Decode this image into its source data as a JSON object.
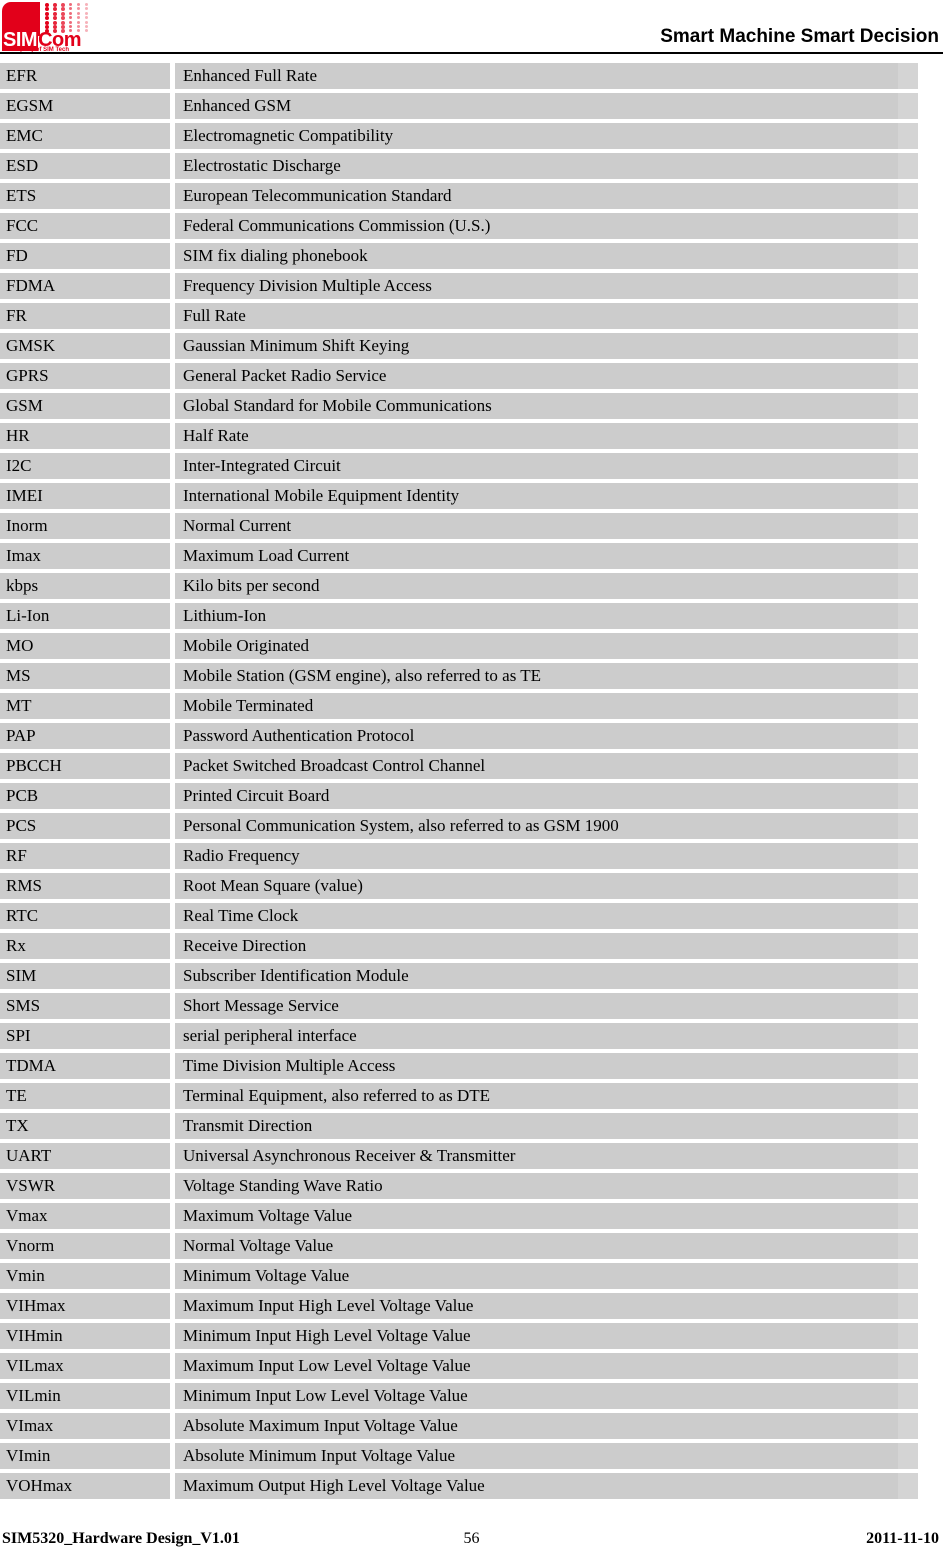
{
  "header": {
    "logo_word_sim": "SIM",
    "logo_word_com": "Com",
    "logo_tagline": "A company of SIM Tech",
    "tagline": "Smart Machine Smart Decision",
    "brand_color": "#e2001a"
  },
  "table": {
    "cell_color": "#cccccc",
    "rows": [
      {
        "term": "EFR",
        "definition": "Enhanced Full Rate"
      },
      {
        "term": "EGSM",
        "definition": "Enhanced GSM"
      },
      {
        "term": "EMC",
        "definition": "Electromagnetic Compatibility"
      },
      {
        "term": "ESD",
        "definition": "Electrostatic Discharge"
      },
      {
        "term": "ETS",
        "definition": "European Telecommunication Standard"
      },
      {
        "term": "FCC",
        "definition": "Federal Communications Commission (U.S.)"
      },
      {
        "term": "FD",
        "definition": "SIM fix dialing phonebook"
      },
      {
        "term": "FDMA",
        "definition": "Frequency Division Multiple Access"
      },
      {
        "term": "FR",
        "definition": "Full Rate"
      },
      {
        "term": "GMSK",
        "definition": "Gaussian Minimum Shift Keying"
      },
      {
        "term": "GPRS",
        "definition": "General Packet Radio Service"
      },
      {
        "term": "GSM",
        "definition": "Global Standard for Mobile Communications"
      },
      {
        "term": "HR",
        "definition": "Half Rate"
      },
      {
        "term": "I2C",
        "definition": "Inter-Integrated Circuit"
      },
      {
        "term": "IMEI",
        "definition": "International Mobile Equipment Identity"
      },
      {
        "term": "Inorm",
        "definition": "Normal Current"
      },
      {
        "term": "Imax",
        "definition": "Maximum Load Current"
      },
      {
        "term": "kbps",
        "definition": "Kilo bits per second"
      },
      {
        "term": "Li-Ion",
        "definition": "Lithium-Ion"
      },
      {
        "term": "MO",
        "definition": "Mobile Originated"
      },
      {
        "term": "MS",
        "definition": "Mobile Station (GSM engine), also referred to as TE"
      },
      {
        "term": "MT",
        "definition": "Mobile Terminated"
      },
      {
        "term": "PAP",
        "definition": "Password Authentication Protocol"
      },
      {
        "term": "PBCCH",
        "definition": "Packet Switched Broadcast Control Channel"
      },
      {
        "term": "PCB",
        "definition": "Printed Circuit Board"
      },
      {
        "term": "PCS",
        "definition": "Personal Communication System, also referred to as GSM 1900"
      },
      {
        "term": "RF",
        "definition": "Radio Frequency"
      },
      {
        "term": "RMS",
        "definition": "Root Mean Square (value)"
      },
      {
        "term": "RTC",
        "definition": "Real Time Clock"
      },
      {
        "term": "Rx",
        "definition": "Receive Direction"
      },
      {
        "term": "SIM",
        "definition": "Subscriber Identification Module"
      },
      {
        "term": "SMS",
        "definition": "Short Message Service"
      },
      {
        "term": "SPI",
        "definition": "serial peripheral interface"
      },
      {
        "term": "TDMA",
        "definition": "Time Division Multiple Access"
      },
      {
        "term": "TE",
        "definition": "Terminal Equipment, also referred to as DTE"
      },
      {
        "term": "TX",
        "definition": "Transmit Direction"
      },
      {
        "term": "UART",
        "definition": "Universal Asynchronous Receiver & Transmitter"
      },
      {
        "term": "VSWR",
        "definition": "Voltage Standing Wave Ratio"
      },
      {
        "term": "Vmax",
        "definition": "Maximum Voltage Value"
      },
      {
        "term": "Vnorm",
        "definition": "Normal Voltage Value"
      },
      {
        "term": "Vmin",
        "definition": "Minimum Voltage Value"
      },
      {
        "term": "VIHmax",
        "definition": "Maximum Input High Level Voltage Value"
      },
      {
        "term": "VIHmin",
        "definition": "Minimum Input High Level Voltage Value"
      },
      {
        "term": "VILmax",
        "definition": "Maximum Input Low Level Voltage Value"
      },
      {
        "term": "VILmin",
        "definition": "Minimum Input Low Level Voltage Value"
      },
      {
        "term": "VImax",
        "definition": "Absolute Maximum Input Voltage Value"
      },
      {
        "term": "VImin",
        "definition": "Absolute Minimum Input Voltage Value"
      },
      {
        "term": "VOHmax",
        "definition": "Maximum Output High Level Voltage Value"
      }
    ]
  },
  "footer": {
    "document": "SIM5320_Hardware Design_V1.01",
    "page_number": "56",
    "date": "2011-11-10"
  }
}
